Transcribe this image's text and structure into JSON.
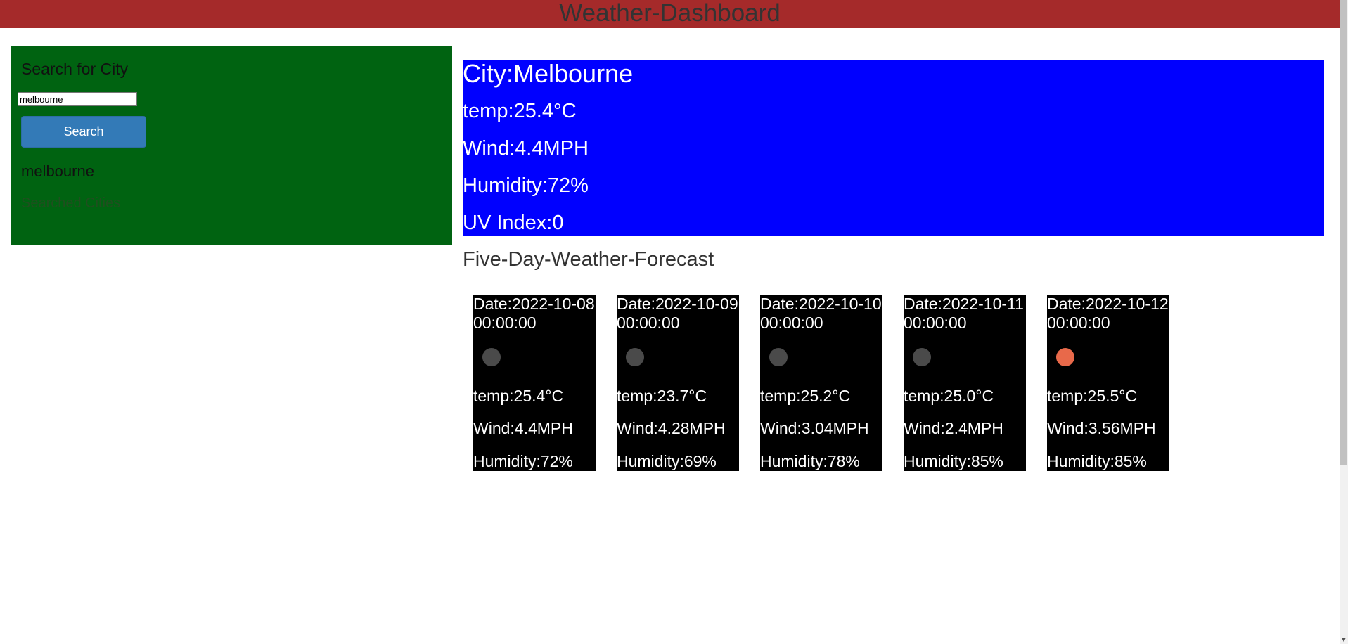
{
  "header": {
    "title": "Weather-Dashboard"
  },
  "search": {
    "title": "Search for City",
    "input_value": "melbourne",
    "button_label": "Search",
    "history": [
      "melbourne"
    ],
    "searched_placeholder": "Searched Cities"
  },
  "current": {
    "city": "City:Melbourne",
    "temp": "temp:25.4°C",
    "wind": "Wind:4.4MPH",
    "humidity": "Humidity:72%",
    "uv": "UV Index:0"
  },
  "forecast": {
    "title": "Five-Day-Weather-Forecast",
    "days": [
      {
        "date": "Date:2022-10-08 00:00:00",
        "icon": "cloud-icon",
        "icon_color": "#4a4a4a",
        "temp": "temp:25.4°C",
        "wind": "Wind:4.4MPH",
        "humidity": "Humidity:72%"
      },
      {
        "date": "Date:2022-10-09 00:00:00",
        "icon": "cloud-icon",
        "icon_color": "#4a4a4a",
        "temp": "temp:23.7°C",
        "wind": "Wind:4.28MPH",
        "humidity": "Humidity:69%"
      },
      {
        "date": "Date:2022-10-10 00:00:00",
        "icon": "cloud-icon",
        "icon_color": "#4a4a4a",
        "temp": "temp:25.2°C",
        "wind": "Wind:3.04MPH",
        "humidity": "Humidity:78%"
      },
      {
        "date": "Date:2022-10-11 00:00:00",
        "icon": "cloud-icon",
        "icon_color": "#4a4a4a",
        "temp": "temp:25.0°C",
        "wind": "Wind:2.4MPH",
        "humidity": "Humidity:85%"
      },
      {
        "date": "Date:2022-10-12 00:00:00",
        "icon": "sun-icon",
        "icon_color": "#e8694a",
        "temp": "temp:25.5°C",
        "wind": "Wind:3.56MPH",
        "humidity": "Humidity:85%"
      }
    ]
  },
  "colors": {
    "header_bg": "#a52a2a",
    "search_panel_bg": "#006311",
    "current_bg": "#0000ff",
    "card_bg": "#000000",
    "button_bg": "#337ab7"
  }
}
